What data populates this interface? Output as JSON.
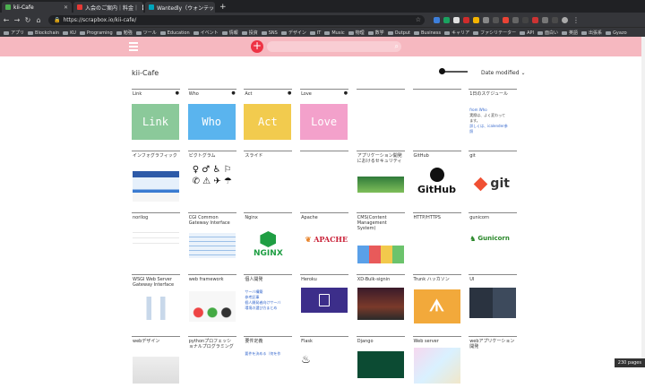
{
  "browser": {
    "tabs": [
      {
        "label": "kii-Cafe",
        "color": "#4caf50",
        "active": true
      },
      {
        "label": "入会のご案内｜料金｜【スポーツジ",
        "color": "#e53935",
        "active": false
      },
      {
        "label": "Wantedly（ウォンテッドリー）| ",
        "color": "#00a4bb",
        "active": false
      }
    ],
    "new_tab": "+",
    "url": "https://scrapbox.io/kii-cafe/",
    "bookmarks": [
      "アプリ",
      "Blockchain",
      "KU",
      "Programing",
      "勉強",
      "ツール",
      "Education",
      "イベント",
      "情報",
      "投資",
      "SNS",
      "デザイン",
      "IT",
      "Music",
      "物理",
      "数学",
      "Output",
      "Business",
      "キャリア",
      "ファシリテーター",
      "API",
      "面白い",
      "英語",
      "出張系",
      "Gyazo"
    ]
  },
  "app": {
    "project_title": "kii-Cafe",
    "sort_label": "Date modified",
    "page_count": "230 pages",
    "accent": "#f6b8c0"
  },
  "cards": [
    {
      "title": "Link",
      "pinned": true,
      "big": "Link",
      "color": "#8bc99a"
    },
    {
      "title": "Who",
      "pinned": true,
      "big": "Who",
      "color": "#5ab4ee"
    },
    {
      "title": "Act",
      "pinned": true,
      "big": "Act",
      "color": "#f2cb4e"
    },
    {
      "title": "Love",
      "pinned": true,
      "big": "Love",
      "color": "#f3a1cb"
    },
    {
      "title": "",
      "pinned": false
    },
    {
      "title": "",
      "pinned": false
    },
    {
      "title": "1日のスケジュール",
      "pinned": false,
      "lines": [
        "from Who",
        "実際は、よく変わって",
        "ます。",
        "詳しくは、icalender参",
        "照"
      ]
    },
    {
      "title": "インフォグラフィック",
      "thumb": "infographic"
    },
    {
      "title": "ピクトグラム",
      "thumb": "pictogram"
    },
    {
      "title": "スライド"
    },
    {
      "title": ""
    },
    {
      "title": "アプリケーション開発におけるセキュリティ",
      "thumb": "green-landscape"
    },
    {
      "title": "GitHub",
      "thumb": "github",
      "brand": "GitHub"
    },
    {
      "title": "git",
      "thumb": "git",
      "brand": "git"
    },
    {
      "title": "norilog",
      "thumb": "sketch"
    },
    {
      "title": "CGI Common Gateway Interface",
      "thumb": "table"
    },
    {
      "title": "Nginx",
      "thumb": "nginx",
      "brand": "NGINX"
    },
    {
      "title": "Apache",
      "thumb": "apache",
      "brand": "APACHE"
    },
    {
      "title": "CMS(Content Management System)",
      "thumb": "cms"
    },
    {
      "title": "HTTP/HTTPS"
    },
    {
      "title": "gunicorn",
      "thumb": "gunicorn",
      "brand": "Gunicorn"
    },
    {
      "title": "WSGI Web Server Gateway Interface",
      "thumb": "diagram"
    },
    {
      "title": "web framework",
      "thumb": "frameworks"
    },
    {
      "title": "個人開発",
      "lines": [
        "サーバ構築",
        "参考記事",
        "個人開発者向けサーバ",
        "環境の選び方まとめ"
      ]
    },
    {
      "title": "Heroku",
      "thumb": "heroku"
    },
    {
      "title": "XD-Bulk-signin",
      "thumb": "xd"
    },
    {
      "title": "Trunk ハッカソン",
      "thumb": "trunk"
    },
    {
      "title": "UI",
      "thumb": "ui"
    },
    {
      "title": "webデザイン",
      "thumb": "webdesign"
    },
    {
      "title": "pythonプロフェッショナルプログラミング",
      "thumb": "none"
    },
    {
      "title": "要件定義",
      "lines": [
        "要件を決める（何を作"
      ]
    },
    {
      "title": "Flask",
      "thumb": "flask"
    },
    {
      "title": "Django",
      "thumb": "django"
    },
    {
      "title": "Web server",
      "thumb": "webserver"
    },
    {
      "title": "webアプリケーション開発",
      "thumb": "none"
    }
  ]
}
